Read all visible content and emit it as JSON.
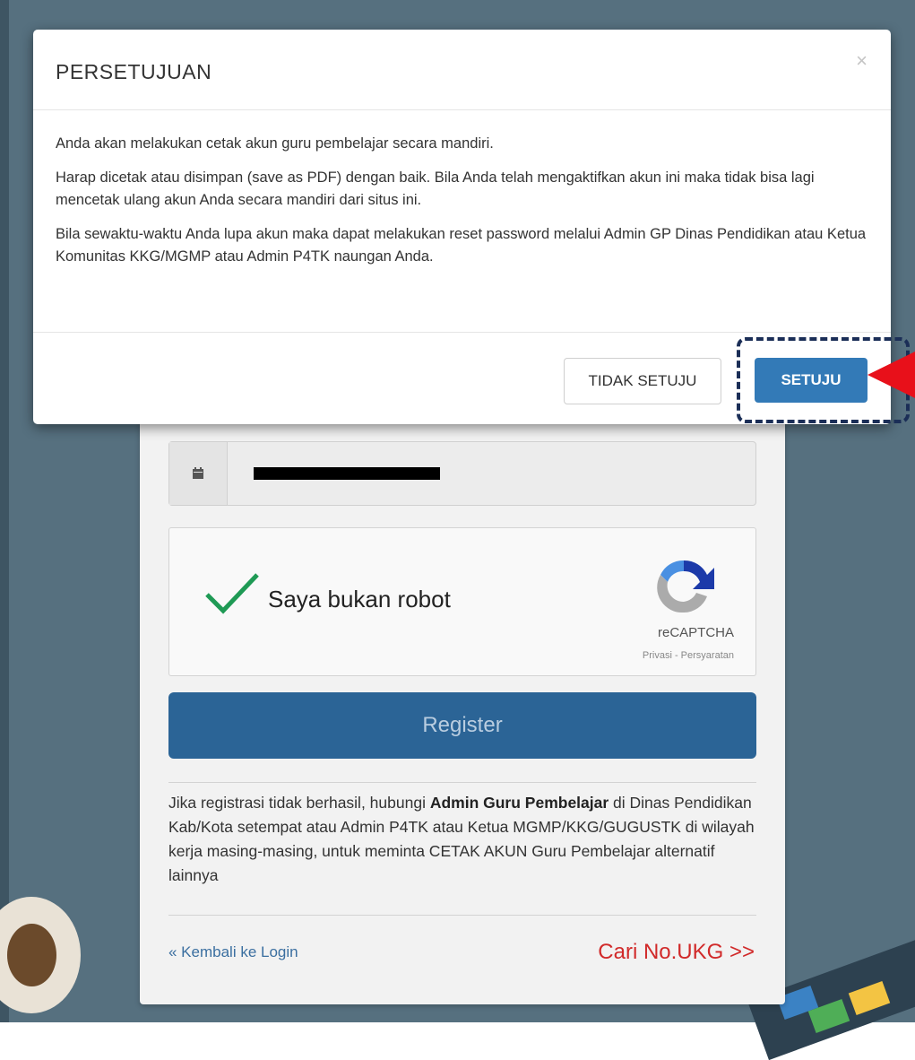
{
  "modal": {
    "title": "PERSETUJUAN",
    "close_label": "×",
    "paragraphs": [
      "Anda akan melakukan cetak akun guru pembelajar secara mandiri.",
      "Harap dicetak atau disimpan (save as PDF) dengan baik. Bila Anda telah mengaktifkan akun ini maka tidak bisa lagi mencetak ulang akun Anda secara mandiri dari situs ini.",
      "Bila sewaktu-waktu Anda lupa akun maka dapat melakukan reset password melalui Admin GP Dinas Pendidikan atau Ketua Komunitas KKG/MGMP atau Admin P4TK naungan Anda."
    ],
    "disagree_label": "TIDAK SETUJU",
    "agree_label": "SETUJU"
  },
  "form": {
    "date_value": "",
    "captcha": {
      "label": "Saya bukan robot",
      "brand": "reCAPTCHA",
      "terms": "Privasi - Persyaratan"
    },
    "register_label": "Register",
    "info": {
      "prefix": "Jika registrasi tidak berhasil, hubungi ",
      "bold": "Admin Guru Pembelajar",
      "suffix": " di Dinas Pendidikan Kab/Kota setempat atau Admin P4TK atau Ketua MGMP/KKG/GUGUSTK di wilayah kerja masing-masing, untuk meminta CETAK AKUN Guru Pembelajar alternatif lainnya"
    },
    "back_link": "« Kembali ke Login",
    "ukg_link": "Cari No.UKG >>"
  },
  "colors": {
    "primary": "#337ab7",
    "register": "#2b6496",
    "highlight": "#1b2e57",
    "arrow": "#e8101a",
    "link_red": "#d12a2a"
  },
  "icons": [
    "calendar-icon",
    "checkmark-icon",
    "recaptcha-logo-icon",
    "pointer-arrow-icon"
  ]
}
